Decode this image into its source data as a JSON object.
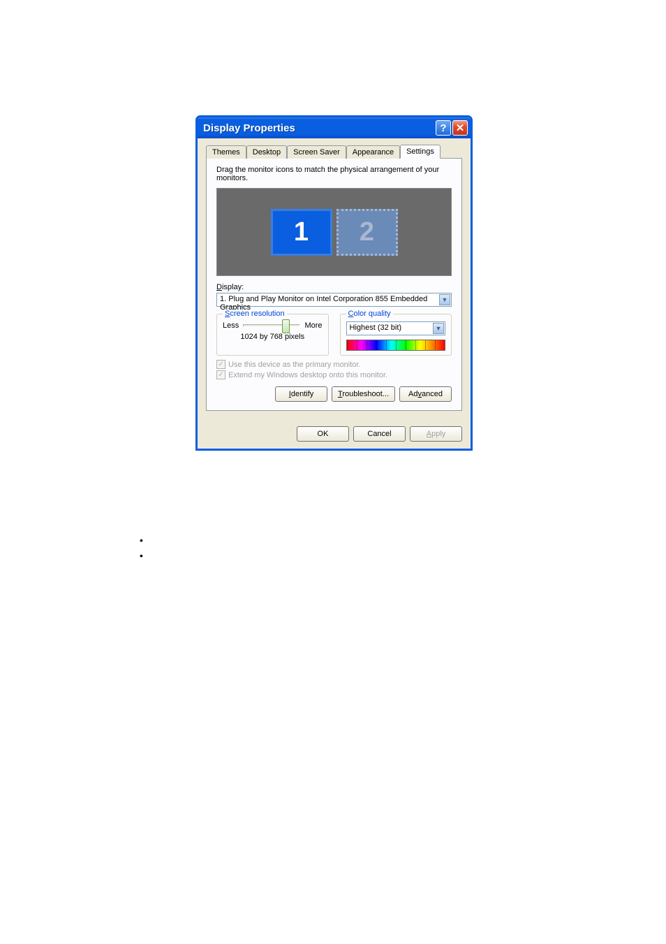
{
  "titlebar": {
    "title": "Display Properties",
    "help": "?",
    "close": "✕"
  },
  "tabs": {
    "themes": "Themes",
    "desktop": "Desktop",
    "screensaver": "Screen Saver",
    "appearance": "Appearance",
    "settings": "Settings"
  },
  "settings_panel": {
    "instruction": "Drag the monitor icons to match the physical arrangement of your monitors.",
    "monitor1": "1",
    "monitor2": "2",
    "display_label_pre": "D",
    "display_label_post": "isplay:",
    "display_value": "1. Plug and Play Monitor on Intel Corporation 855 Embedded Graphics",
    "res_legend_pre": "S",
    "res_legend_post": "creen resolution",
    "less": "Less",
    "more": "More",
    "res_value": "1024 by 768 pixels",
    "color_legend_pre": "C",
    "color_legend_post": "olor quality",
    "color_value": "Highest (32 bit)",
    "chk1_pre": "U",
    "chk1_post": "se this device as the primary monitor.",
    "chk2_pre": "E",
    "chk2_post": "xtend my Windows desktop onto this monitor.",
    "identify_pre": "I",
    "identify_post": "dentify",
    "trouble_pre": "T",
    "trouble_post": "roubleshoot...",
    "advanced_pre": "Ad",
    "advanced_u": "v",
    "advanced_post": "anced"
  },
  "buttons": {
    "ok": "OK",
    "cancel": "Cancel",
    "apply_pre": "A",
    "apply_post": "pply"
  }
}
